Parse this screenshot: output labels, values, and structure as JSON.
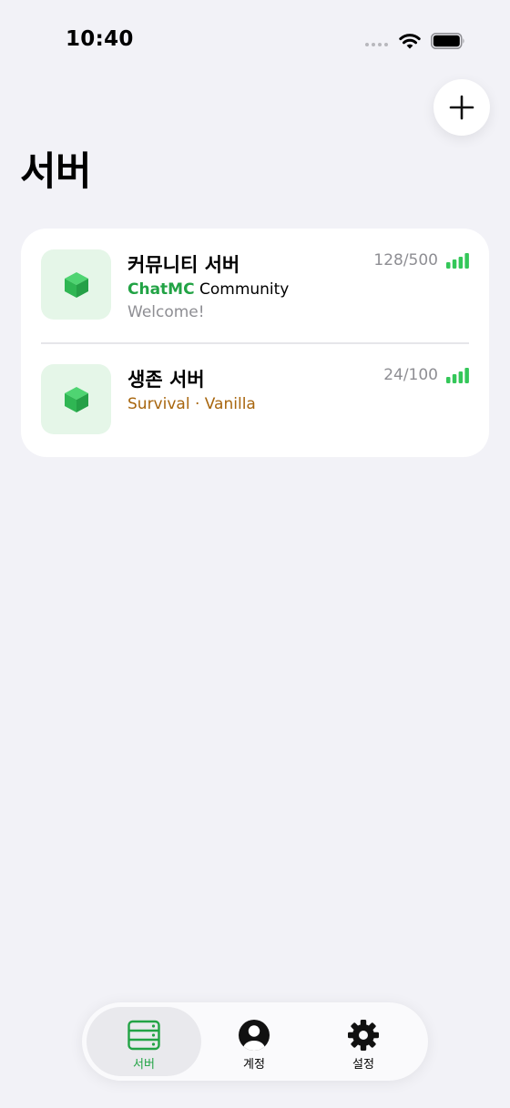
{
  "status_bar": {
    "time": "10:40",
    "icons": [
      "signal-icon",
      "wifi-icon",
      "battery-icon"
    ]
  },
  "header": {
    "title": "서버",
    "add_icon": "plus-icon"
  },
  "servers": [
    {
      "name": "커뮤니티 서버",
      "subtitle_brand": "ChatMC",
      "subtitle_rest": " Community",
      "motd": "Welcome!",
      "players": "128/500",
      "icon": "cube-icon"
    },
    {
      "name": "생존 서버",
      "tags": "Survival · Vanilla",
      "players": "24/100",
      "icon": "cube-icon"
    }
  ],
  "tabs": [
    {
      "label": "서버",
      "icon": "server-rack-icon",
      "selected": true
    },
    {
      "label": "계정",
      "icon": "person-circle-icon",
      "selected": false
    },
    {
      "label": "설정",
      "icon": "gear-icon",
      "selected": false
    }
  ],
  "colors": {
    "accent": "#22a345",
    "tag": "#a8660e",
    "background": "#f2f2f7",
    "icon_tint": "#34c759"
  }
}
